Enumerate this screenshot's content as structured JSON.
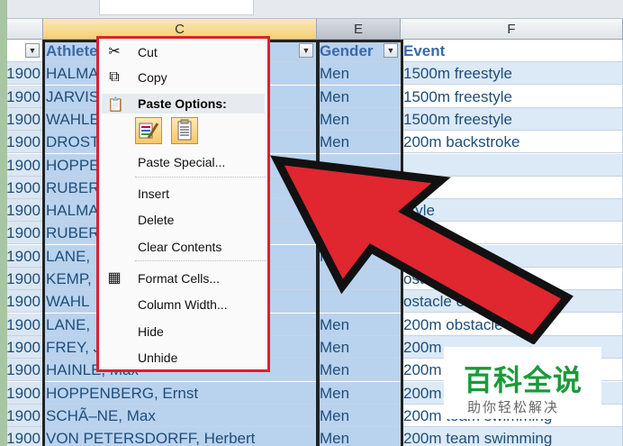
{
  "columns": {
    "c": "C",
    "e": "E",
    "f": "F"
  },
  "header_row": {
    "a": "",
    "c": "Athlete",
    "e": "Gender",
    "f": "Event"
  },
  "rows": [
    {
      "year": "1900",
      "athlete": "HALMA",
      "gender": "Men",
      "event": "1500m freestyle"
    },
    {
      "year": "1900",
      "athlete": "JARVIS",
      "gender": "Men",
      "event": "1500m freestyle"
    },
    {
      "year": "1900",
      "athlete": "WAHLE",
      "gender": "Men",
      "event": "1500m freestyle"
    },
    {
      "year": "1900",
      "athlete": "DROST",
      "gender": "Men",
      "event": "200m backstroke"
    },
    {
      "year": "1900",
      "athlete": "HOPPE",
      "gender": "",
      "event": ""
    },
    {
      "year": "1900",
      "athlete": "RUBER",
      "gender": "",
      "event": "e"
    },
    {
      "year": "1900",
      "athlete": "HALMA",
      "gender": "",
      "event": "style"
    },
    {
      "year": "1900",
      "athlete": "RUBER",
      "gender": "Me",
      "event": ""
    },
    {
      "year": "1900",
      "athlete": "LANE,",
      "gender": "Men",
      "event": ""
    },
    {
      "year": "1900",
      "athlete": "KEMP,",
      "gender": "",
      "event": "ostacle"
    },
    {
      "year": "1900",
      "athlete": "WAHL",
      "gender": "",
      "event": "ostacle event"
    },
    {
      "year": "1900",
      "athlete": "LANE,",
      "gender": "Men",
      "event": "200m obstacle event"
    },
    {
      "year": "1900",
      "athlete": "FREY, J",
      "gender": "Men",
      "event": "200m"
    },
    {
      "year": "1900",
      "athlete": "HAINLE, Max",
      "gender": "Men",
      "event": "200m"
    },
    {
      "year": "1900",
      "athlete": "HOPPENBERG, Ernst",
      "gender": "Men",
      "event": "200m"
    },
    {
      "year": "1900",
      "athlete": "SCHÃ–NE, Max",
      "gender": "Men",
      "event": "200m team swimming"
    },
    {
      "year": "1900",
      "athlete": "VON PETERSDORFF, Herbert",
      "gender": "Men",
      "event": "200m team swimming"
    }
  ],
  "context_menu": {
    "cut": "Cut",
    "copy": "Copy",
    "paste_options": "Paste Options:",
    "paste_special": "Paste Special...",
    "insert": "Insert",
    "delete": "Delete",
    "clear_contents": "Clear Contents",
    "format_cells": "Format Cells...",
    "column_width": "Column Width...",
    "hide": "Hide",
    "unhide": "Unhide"
  },
  "watermark": {
    "title": "百科全说",
    "subtitle": "助你轻松解决"
  },
  "colors": {
    "arrow": "#e0262f",
    "menu_border": "#e01f2c",
    "selection": "#b9d2ee",
    "text": "#1f4e79"
  }
}
